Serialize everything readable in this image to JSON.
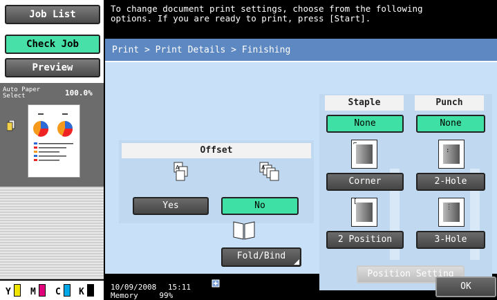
{
  "left_panel": {
    "job_list": "Job List",
    "check_job": "Check Job",
    "preview": "Preview",
    "paper_select": "Auto Paper\nSelect",
    "zoom": "100.0%",
    "toner": [
      "Y",
      "M",
      "C",
      "K"
    ]
  },
  "message": "To change document print settings, choose from the following\noptions. If you are ready to print, press [Start].",
  "breadcrumb": "Print > Print Details > Finishing",
  "offset": {
    "title": "Offset",
    "yes": "Yes",
    "no": "No",
    "selected": "No"
  },
  "fold_bind": "Fold/Bind",
  "staple": {
    "title": "Staple",
    "none": "None",
    "corner": "Corner",
    "two_position": "2 Position",
    "selected": "None"
  },
  "punch": {
    "title": "Punch",
    "none": "None",
    "two_hole": "2-Hole",
    "three_hole": "3-Hole",
    "selected": "None"
  },
  "position_setting": "Position Setting",
  "ok": "OK",
  "status": {
    "date": "10/09/2008",
    "time": "15:11",
    "memory_label": "Memory",
    "memory_value": "99%"
  },
  "colors": {
    "accent_green": "#3fe0a6",
    "header_blue": "#5e88c2",
    "panel_blue": "#c8e0f8",
    "toner_yellow": "#f2e600",
    "toner_magenta": "#e0007a",
    "toner_cyan": "#00a8e8",
    "toner_black": "#000000"
  }
}
